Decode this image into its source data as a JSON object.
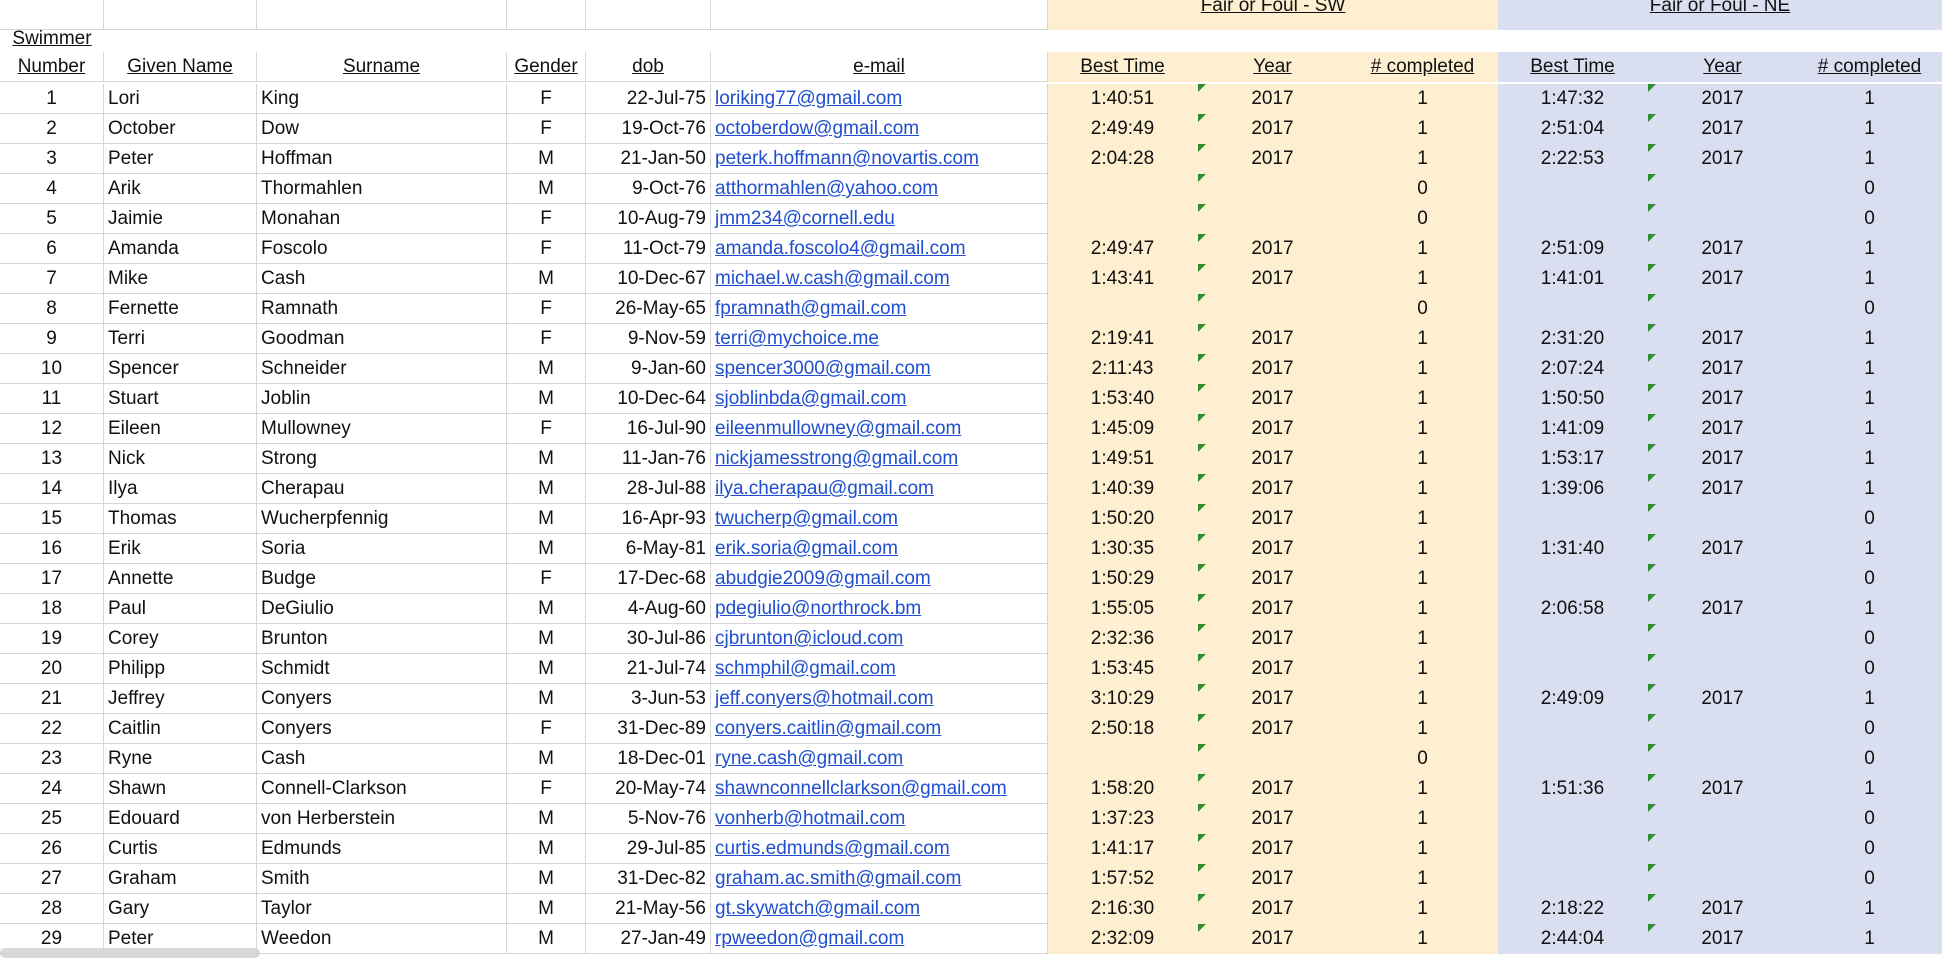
{
  "groups": {
    "sw": "Fair or Foul - SW",
    "ne": "Fair or Foul - NE"
  },
  "headers": {
    "number_top": "Swimmer",
    "number_bottom": "Number",
    "given": "Given Name",
    "surname": "Surname",
    "gender": "Gender",
    "dob": "dob",
    "email": "e-mail",
    "sw_best": "Best Time",
    "sw_year": "Year",
    "sw_completed": "# completed",
    "ne_best": "Best Time",
    "ne_year": "Year",
    "ne_completed": "# completed"
  },
  "colors": {
    "sw_band": "#fdefcf",
    "ne_band": "#d9dff0",
    "link": "#1f4fcf",
    "comment_marker": "#2f8f2f"
  },
  "rows": [
    {
      "num": "1",
      "given": "Lori",
      "surname": "King",
      "gender": "F",
      "dob": "22-Jul-75",
      "email": "loriking77@gmail.com",
      "sw_time": "1:40:51",
      "sw_year": "2017",
      "sw_done": "1",
      "ne_time": "1:47:32",
      "ne_year": "2017",
      "ne_done": "1"
    },
    {
      "num": "2",
      "given": "October",
      "surname": "Dow",
      "gender": "F",
      "dob": "19-Oct-76",
      "email": "octoberdow@gmail.com",
      "sw_time": "2:49:49",
      "sw_year": "2017",
      "sw_done": "1",
      "ne_time": "2:51:04",
      "ne_year": "2017",
      "ne_done": "1"
    },
    {
      "num": "3",
      "given": "Peter",
      "surname": "Hoffman",
      "gender": "M",
      "dob": "21-Jan-50",
      "email": "peterk.hoffmann@novartis.com",
      "sw_time": "2:04:28",
      "sw_year": "2017",
      "sw_done": "1",
      "ne_time": "2:22:53",
      "ne_year": "2017",
      "ne_done": "1"
    },
    {
      "num": "4",
      "given": "Arik",
      "surname": "Thormahlen",
      "gender": "M",
      "dob": "9-Oct-76",
      "email": "atthormahlen@yahoo.com",
      "sw_time": "",
      "sw_year": "",
      "sw_done": "0",
      "ne_time": "",
      "ne_year": "",
      "ne_done": "0"
    },
    {
      "num": "5",
      "given": "Jaimie",
      "surname": "Monahan",
      "gender": "F",
      "dob": "10-Aug-79",
      "email": "jmm234@cornell.edu",
      "sw_time": "",
      "sw_year": "",
      "sw_done": "0",
      "ne_time": "",
      "ne_year": "",
      "ne_done": "0"
    },
    {
      "num": "6",
      "given": "Amanda",
      "surname": "Foscolo",
      "gender": "F",
      "dob": "11-Oct-79",
      "email": "amanda.foscolo4@gmail.com",
      "sw_time": "2:49:47",
      "sw_year": "2017",
      "sw_done": "1",
      "ne_time": "2:51:09",
      "ne_year": "2017",
      "ne_done": "1"
    },
    {
      "num": "7",
      "given": "Mike",
      "surname": "Cash",
      "gender": "M",
      "dob": "10-Dec-67",
      "email": "michael.w.cash@gmail.com",
      "sw_time": "1:43:41",
      "sw_year": "2017",
      "sw_done": "1",
      "ne_time": "1:41:01",
      "ne_year": "2017",
      "ne_done": "1"
    },
    {
      "num": "8",
      "given": "Fernette",
      "surname": "Ramnath",
      "gender": "F",
      "dob": "26-May-65",
      "email": "fpramnath@gmail.com",
      "sw_time": "",
      "sw_year": "",
      "sw_done": "0",
      "ne_time": "",
      "ne_year": "",
      "ne_done": "0"
    },
    {
      "num": "9",
      "given": "Terri",
      "surname": "Goodman",
      "gender": "F",
      "dob": "9-Nov-59",
      "email": "terri@mychoice.me",
      "sw_time": "2:19:41",
      "sw_year": "2017",
      "sw_done": "1",
      "ne_time": "2:31:20",
      "ne_year": "2017",
      "ne_done": "1"
    },
    {
      "num": "10",
      "given": "Spencer",
      "surname": "Schneider",
      "gender": "M",
      "dob": "9-Jan-60",
      "email": "spencer3000@gmail.com",
      "sw_time": "2:11:43",
      "sw_year": "2017",
      "sw_done": "1",
      "ne_time": "2:07:24",
      "ne_year": "2017",
      "ne_done": "1"
    },
    {
      "num": "11",
      "given": "Stuart",
      "surname": "Joblin",
      "gender": "M",
      "dob": "10-Dec-64",
      "email": "sjoblinbda@gmail.com",
      "sw_time": "1:53:40",
      "sw_year": "2017",
      "sw_done": "1",
      "ne_time": "1:50:50",
      "ne_year": "2017",
      "ne_done": "1"
    },
    {
      "num": "12",
      "given": "Eileen",
      "surname": "Mullowney",
      "gender": "F",
      "dob": "16-Jul-90",
      "email": "eileenmullowney@gmail.com",
      "sw_time": "1:45:09",
      "sw_year": "2017",
      "sw_done": "1",
      "ne_time": "1:41:09",
      "ne_year": "2017",
      "ne_done": "1"
    },
    {
      "num": "13",
      "given": "Nick",
      "surname": "Strong",
      "gender": "M",
      "dob": "11-Jan-76",
      "email": "nickjamesstrong@gmail.com",
      "sw_time": "1:49:51",
      "sw_year": "2017",
      "sw_done": "1",
      "ne_time": "1:53:17",
      "ne_year": "2017",
      "ne_done": "1"
    },
    {
      "num": "14",
      "given": "Ilya",
      "surname": "Cherapau",
      "gender": "M",
      "dob": "28-Jul-88",
      "email": "ilya.cherapau@gmail.com",
      "sw_time": "1:40:39",
      "sw_year": "2017",
      "sw_done": "1",
      "ne_time": "1:39:06",
      "ne_year": "2017",
      "ne_done": "1"
    },
    {
      "num": "15",
      "given": "Thomas",
      "surname": "Wucherpfennig",
      "gender": "M",
      "dob": "16-Apr-93",
      "email": "twucherp@gmail.com",
      "sw_time": "1:50:20",
      "sw_year": "2017",
      "sw_done": "1",
      "ne_time": "",
      "ne_year": "",
      "ne_done": "0"
    },
    {
      "num": "16",
      "given": "Erik",
      "surname": "Soria",
      "gender": "M",
      "dob": "6-May-81",
      "email": "erik.soria@gmail.com",
      "sw_time": "1:30:35",
      "sw_year": "2017",
      "sw_done": "1",
      "ne_time": "1:31:40",
      "ne_year": "2017",
      "ne_done": "1"
    },
    {
      "num": "17",
      "given": "Annette",
      "surname": "Budge",
      "gender": "F",
      "dob": "17-Dec-68",
      "email": "abudgie2009@gmail.com",
      "sw_time": "1:50:29",
      "sw_year": "2017",
      "sw_done": "1",
      "ne_time": "",
      "ne_year": "",
      "ne_done": "0"
    },
    {
      "num": "18",
      "given": "Paul",
      "surname": "DeGiulio",
      "gender": "M",
      "dob": "4-Aug-60",
      "email": "pdegiulio@northrock.bm",
      "sw_time": "1:55:05",
      "sw_year": "2017",
      "sw_done": "1",
      "ne_time": "2:06:58",
      "ne_year": "2017",
      "ne_done": "1"
    },
    {
      "num": "19",
      "given": "Corey",
      "surname": "Brunton",
      "gender": "M",
      "dob": "30-Jul-86",
      "email": "cjbrunton@icloud.com",
      "sw_time": "2:32:36",
      "sw_year": "2017",
      "sw_done": "1",
      "ne_time": "",
      "ne_year": "",
      "ne_done": "0"
    },
    {
      "num": "20",
      "given": "Philipp",
      "surname": "Schmidt",
      "gender": "M",
      "dob": "21-Jul-74",
      "email": "schmphil@gmail.com",
      "sw_time": "1:53:45",
      "sw_year": "2017",
      "sw_done": "1",
      "ne_time": "",
      "ne_year": "",
      "ne_done": "0"
    },
    {
      "num": "21",
      "given": "Jeffrey",
      "surname": "Conyers",
      "gender": "M",
      "dob": "3-Jun-53",
      "email": "jeff.conyers@hotmail.com",
      "sw_time": "3:10:29",
      "sw_year": "2017",
      "sw_done": "1",
      "ne_time": "2:49:09",
      "ne_year": "2017",
      "ne_done": "1"
    },
    {
      "num": "22",
      "given": "Caitlin",
      "surname": "Conyers",
      "gender": "F",
      "dob": "31-Dec-89",
      "email": "conyers.caitlin@gmail.com",
      "sw_time": "2:50:18",
      "sw_year": "2017",
      "sw_done": "1",
      "ne_time": "",
      "ne_year": "",
      "ne_done": "0"
    },
    {
      "num": "23",
      "given": "Ryne",
      "surname": "Cash",
      "gender": "M",
      "dob": "18-Dec-01",
      "email": "ryne.cash@gmail.com",
      "sw_time": "",
      "sw_year": "",
      "sw_done": "0",
      "ne_time": "",
      "ne_year": "",
      "ne_done": "0"
    },
    {
      "num": "24",
      "given": "Shawn",
      "surname": "Connell-Clarkson",
      "gender": "F",
      "dob": "20-May-74",
      "email": "shawnconnellclarkson@gmail.com",
      "sw_time": "1:58:20",
      "sw_year": "2017",
      "sw_done": "1",
      "ne_time": "1:51:36",
      "ne_year": "2017",
      "ne_done": "1"
    },
    {
      "num": "25",
      "given": "Edouard",
      "surname": "von Herberstein",
      "gender": "M",
      "dob": "5-Nov-76",
      "email": "vonherb@hotmail.com",
      "sw_time": "1:37:23",
      "sw_year": "2017",
      "sw_done": "1",
      "ne_time": "",
      "ne_year": "",
      "ne_done": "0"
    },
    {
      "num": "26",
      "given": "Curtis",
      "surname": "Edmunds",
      "gender": "M",
      "dob": "29-Jul-85",
      "email": "curtis.edmunds@gmail.com",
      "sw_time": "1:41:17",
      "sw_year": "2017",
      "sw_done": "1",
      "ne_time": "",
      "ne_year": "",
      "ne_done": "0"
    },
    {
      "num": "27",
      "given": "Graham",
      "surname": "Smith",
      "gender": "M",
      "dob": "31-Dec-82",
      "email": "graham.ac.smith@gmail.com",
      "sw_time": "1:57:52",
      "sw_year": "2017",
      "sw_done": "1",
      "ne_time": "",
      "ne_year": "",
      "ne_done": "0"
    },
    {
      "num": "28",
      "given": "Gary",
      "surname": "Taylor",
      "gender": "M",
      "dob": "21-May-56",
      "email": "gt.skywatch@gmail.com",
      "sw_time": "2:16:30",
      "sw_year": "2017",
      "sw_done": "1",
      "ne_time": "2:18:22",
      "ne_year": "2017",
      "ne_done": "1"
    },
    {
      "num": "29",
      "given": "Peter",
      "surname": "Weedon",
      "gender": "M",
      "dob": "27-Jan-49",
      "email": "rpweedon@gmail.com",
      "sw_time": "2:32:09",
      "sw_year": "2017",
      "sw_done": "1",
      "ne_time": "2:44:04",
      "ne_year": "2017",
      "ne_done": "1"
    }
  ]
}
